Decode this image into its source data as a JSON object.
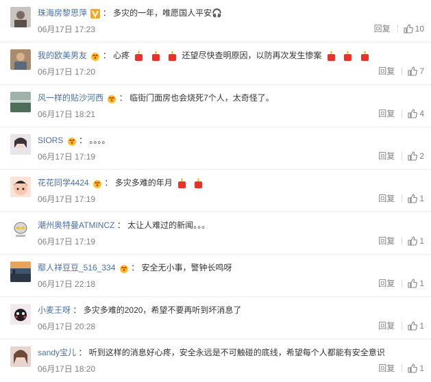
{
  "comments": [
    {
      "user": "珠海房黎思萍",
      "badge": "vip-v",
      "text": "多灾的一年，唯愿国人平安🎧",
      "time": "06月17日 17:23",
      "reply": "回复",
      "likes": "10",
      "emojis": 0
    },
    {
      "user": "我的欧美男友",
      "badge": "crown",
      "text1": "心疼",
      "text2": "还望尽快查明原因，以防再次发生惨案",
      "time": "06月17日 17:20",
      "reply": "回复",
      "likes": "7"
    },
    {
      "user": "风一样的贴沙河西",
      "badge": "crown",
      "text": "临街门面房也会烧死7个人，太奇怪了。",
      "time": "06月17日 18:21",
      "reply": "回复",
      "likes": "4"
    },
    {
      "user": "SIORS",
      "badge": "crown",
      "text": "。。。。",
      "time": "06月17日 17:19",
      "reply": "回复",
      "likes": "2"
    },
    {
      "user": "花花同学4424",
      "badge": "crown",
      "text": "多灾多难的年月",
      "time": "06月17日 17:19",
      "reply": "回复",
      "likes": "1"
    },
    {
      "user": "潮州奥特曼ATMINCZ",
      "text": "太让人难过的新闻。。。",
      "time": "06月17日 17:19",
      "reply": "回复",
      "likes": "1"
    },
    {
      "user": "鄢人祥豆豆_516_334",
      "badge": "crown",
      "text": "安全无小事，警钟长鸣呀",
      "time": "06月17日 22:18",
      "reply": "回复",
      "likes": "1"
    },
    {
      "user": "小麦王呀",
      "text": "多灾多难的2020，希望不要再听到坏消息了",
      "time": "06月17日 20:28",
      "reply": "回复",
      "likes": "1"
    },
    {
      "user": "sandy宝儿",
      "text": "听到这样的消息好心疼，安全永远是不可触碰的底线，希望每个人都能有安全意识",
      "time": "06月17日 18:20",
      "reply": "回复",
      "likes": "1"
    }
  ],
  "separator": "：",
  "colors": {
    "username": "#4a6fa5",
    "text": "#333333",
    "meta": "#808080",
    "candle": "#e8322a"
  }
}
